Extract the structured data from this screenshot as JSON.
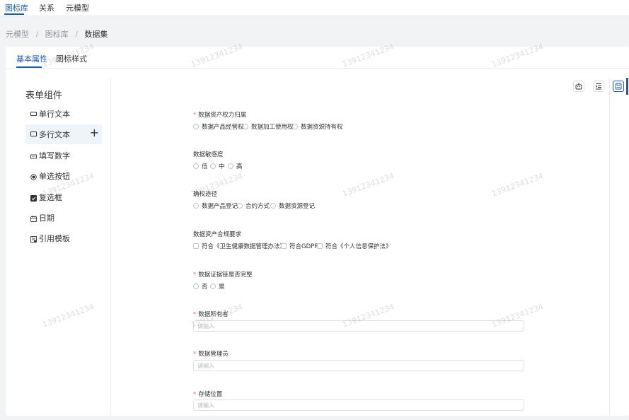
{
  "topnav": {
    "items": [
      "图标库",
      "关系",
      "元模型"
    ]
  },
  "breadcrumb": {
    "items": [
      "元模型",
      "图标库",
      "数据集"
    ],
    "separator": "/"
  },
  "tabs": [
    "基本属性",
    "图标样式"
  ],
  "panel": {
    "title": "表单组件",
    "items": [
      {
        "label": "单行文本",
        "icon": "single-line-text-icon"
      },
      {
        "label": "多行文本",
        "icon": "multi-line-text-icon"
      },
      {
        "label": "填写数字",
        "icon": "number-input-icon"
      },
      {
        "label": "单选按钮",
        "icon": "radio-button-icon"
      },
      {
        "label": "复选框",
        "icon": "checkbox-icon"
      },
      {
        "label": "日期",
        "icon": "calendar-icon"
      },
      {
        "label": "引用模板",
        "icon": "template-icon"
      }
    ]
  },
  "toolbar": {
    "icons": [
      "robot-icon",
      "indent-icon",
      "save-icon"
    ]
  },
  "form": {
    "fields": [
      {
        "label": "数据资产权力归属",
        "required": true,
        "type": "radio",
        "options": [
          "数据产品经营权",
          "数据加工使用权",
          "数据资源持有权"
        ]
      },
      {
        "label": "数据敏感度",
        "required": false,
        "type": "radio",
        "options": [
          "低",
          "中",
          "高"
        ]
      },
      {
        "label": "确权途径",
        "required": false,
        "type": "radio",
        "options": [
          "数据产品登记",
          "合约方式",
          "数据资源登记"
        ]
      },
      {
        "label": "数据资产合规要求",
        "required": false,
        "type": "checkbox",
        "options": [
          "符合《卫生健康数据管理办法》",
          "符合GDPR",
          "符合《个人信息保护法》"
        ]
      },
      {
        "label": "数据证据链是否完整",
        "required": true,
        "type": "radio",
        "options": [
          "否",
          "是"
        ]
      },
      {
        "label": "数据所有者",
        "required": true,
        "type": "input",
        "placeholder": "请输入"
      },
      {
        "label": "数据管理员",
        "required": true,
        "type": "input",
        "placeholder": "请输入"
      },
      {
        "label": "存储位置",
        "required": true,
        "type": "input",
        "placeholder": "请输入"
      }
    ]
  },
  "watermark": "13912341234",
  "colors": {
    "accent": "#1d5aaa",
    "required": "#f56c6c",
    "border": "#dcdfe6"
  }
}
